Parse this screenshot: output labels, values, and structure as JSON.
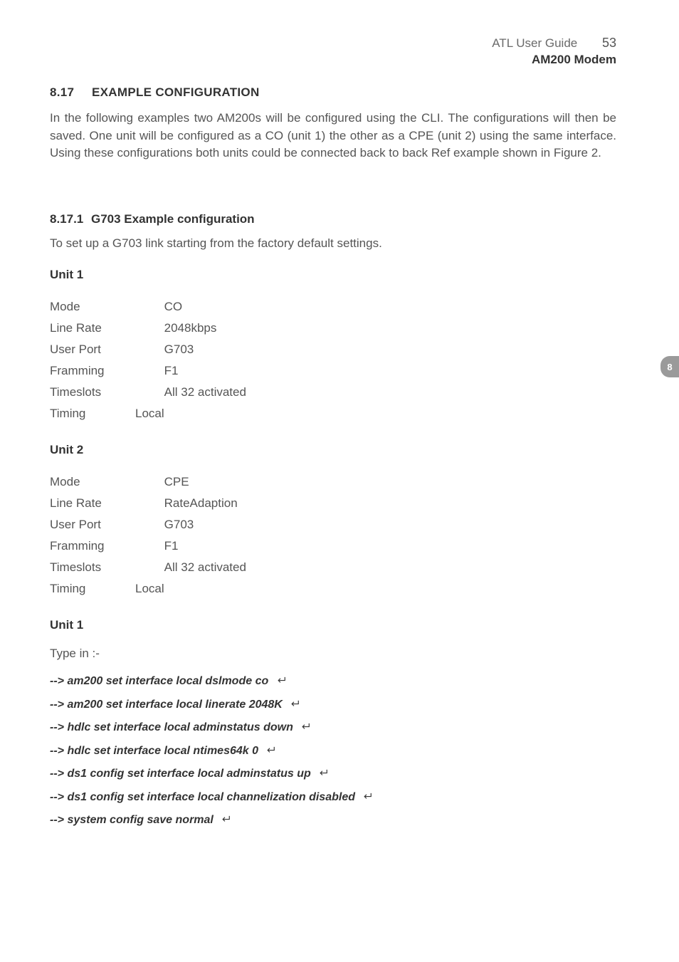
{
  "header": {
    "guide": "ATL User Guide",
    "pagenum": "53",
    "device": "AM200 Modem"
  },
  "sideTab": "8",
  "section": {
    "num": "8.17",
    "title": "EXAMPLE CONFIGURATION",
    "intro": "In the following examples two AM200s will be configured using the CLI. The configurations will then be saved. One unit will be configured as a CO (unit 1) the other as a CPE (unit 2) using the same interface. Using these configurations both units could be connected back to back Ref example shown in Figure 2."
  },
  "subsection": {
    "num": "8.17.1",
    "title": "G703 Example configuration",
    "intro": "To set up a G703 link starting from the factory default settings."
  },
  "unit1": {
    "heading": "Unit 1",
    "rows": [
      {
        "k": "Mode",
        "m": "",
        "v": "CO"
      },
      {
        "k": "Line Rate",
        "m": "",
        "v": "2048kbps"
      },
      {
        "k": "User Port",
        "m": "",
        "v": "G703"
      },
      {
        "k": "Framming",
        "m": "",
        "v": "F1"
      },
      {
        "k": "Timeslots",
        "m": "",
        "v": "All 32 activated"
      },
      {
        "k": "Timing",
        "m": "Local",
        "v": ""
      }
    ]
  },
  "unit2": {
    "heading": "Unit 2",
    "rows": [
      {
        "k": "Mode",
        "m": "",
        "v": "CPE"
      },
      {
        "k": "Line Rate",
        "m": "",
        "v": " RateAdaption"
      },
      {
        "k": "User Port",
        "m": "",
        "v": "G703"
      },
      {
        "k": "Framming",
        "m": "",
        "v": "F1"
      },
      {
        "k": "Timeslots",
        "m": "",
        "v": "All 32 activated"
      },
      {
        "k": "Timing",
        "m": "Local",
        "v": ""
      }
    ]
  },
  "cmdblock": {
    "heading": "Unit 1",
    "typein": "Type in :-",
    "cmds": [
      "--> am200 set interface local dslmode co",
      "--> am200 set interface local linerate 2048K",
      "--> hdlc set interface local adminstatus down",
      "--> hdlc set interface local ntimes64k 0",
      "--> ds1 config set interface local adminstatus up",
      "--> ds1 config set interface local channelization disabled",
      "--> system config save normal"
    ]
  }
}
